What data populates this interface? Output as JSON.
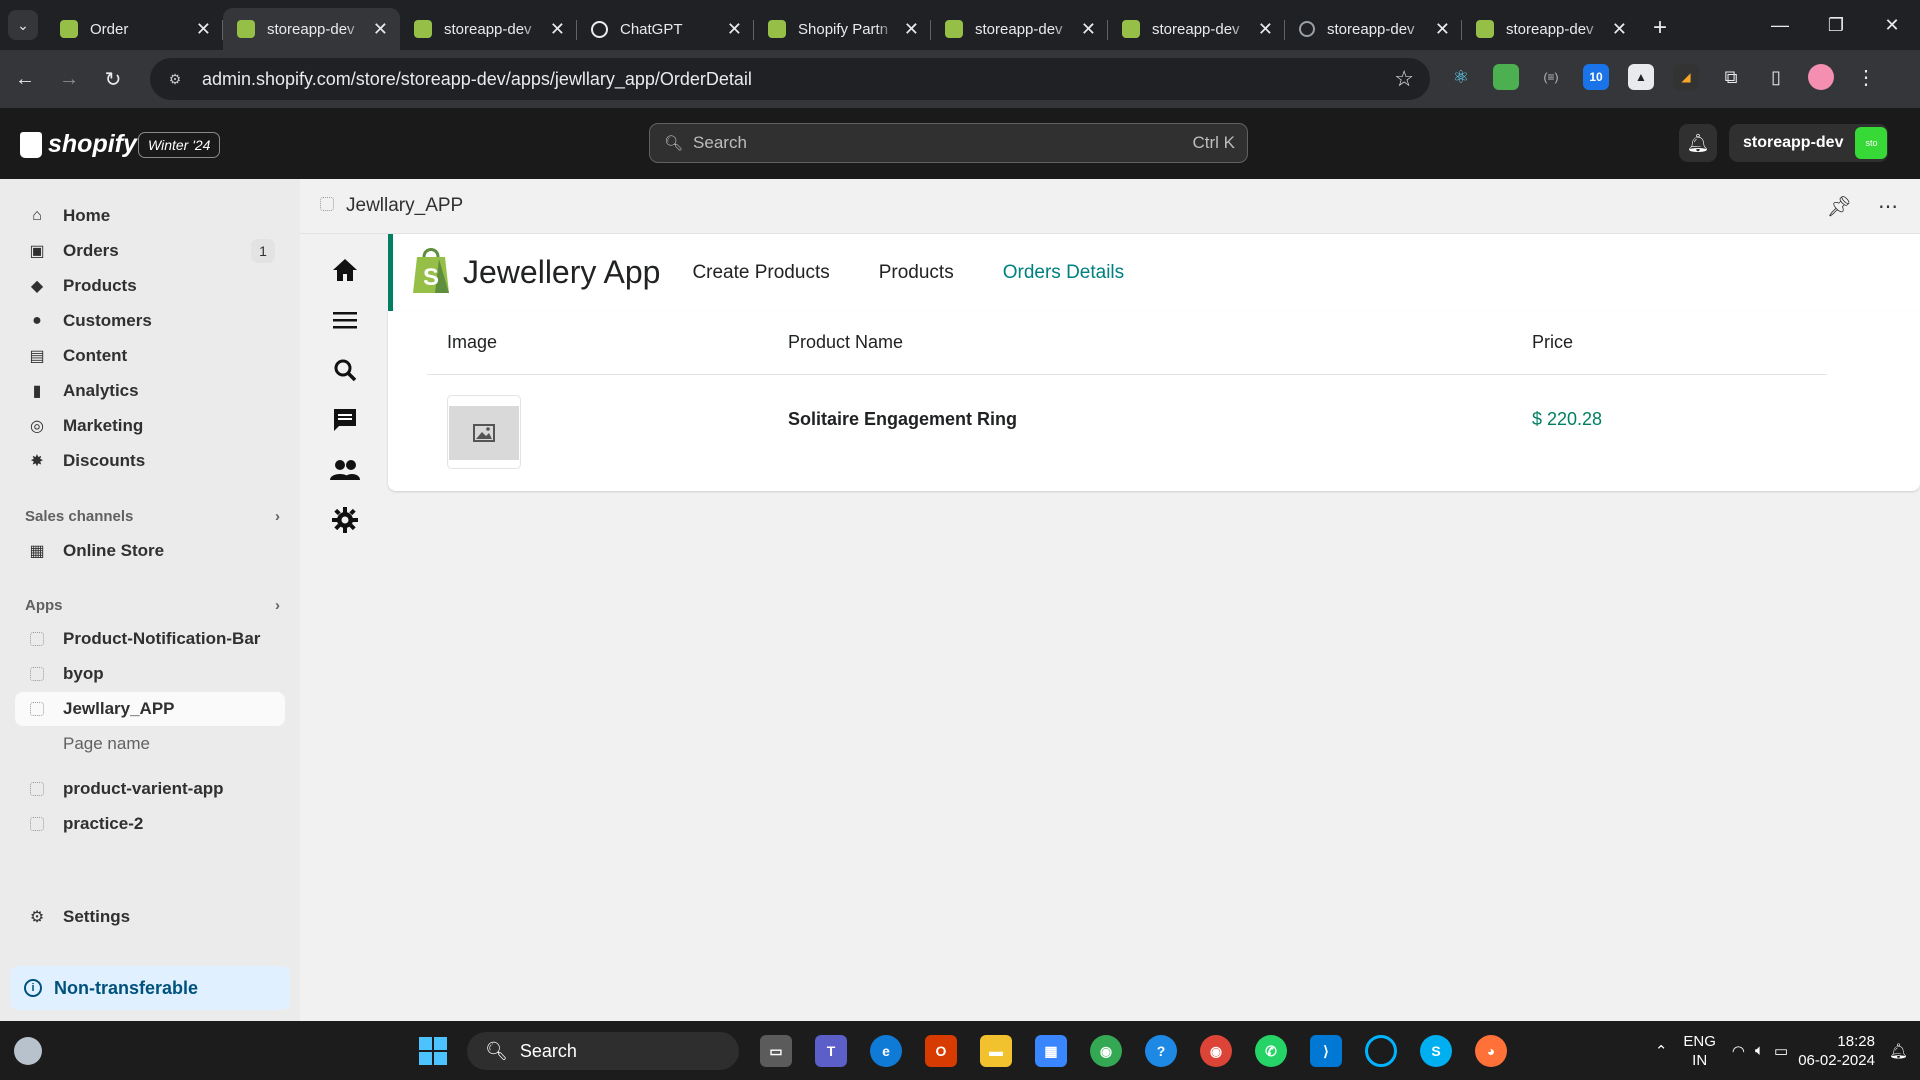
{
  "browser": {
    "tabs": [
      {
        "title": "Order",
        "icon": "shopify-icon",
        "active": false
      },
      {
        "title": "storeapp-dev",
        "icon": "shopify-icon",
        "active": true
      },
      {
        "title": "storeapp-dev",
        "icon": "shopify-icon",
        "active": false
      },
      {
        "title": "ChatGPT",
        "icon": "chatgpt-icon",
        "active": false
      },
      {
        "title": "Shopify Partn",
        "icon": "shopify-icon",
        "active": false
      },
      {
        "title": "storeapp-dev",
        "icon": "shopify-icon",
        "active": false
      },
      {
        "title": "storeapp-dev",
        "icon": "shopify-icon",
        "active": false
      },
      {
        "title": "storeapp-dev",
        "icon": "globe-icon",
        "active": false
      },
      {
        "title": "storeapp-dev",
        "icon": "shopify-icon",
        "active": false
      }
    ],
    "url": "admin.shopify.com/store/storeapp-dev/apps/jewllary_app/OrderDetail"
  },
  "shopify": {
    "brand": "shopify",
    "edition": "Winter '24",
    "search_placeholder": "Search",
    "search_shortcut": "Ctrl K",
    "store_name": "storeapp-dev",
    "store_avatar": "sto",
    "accent_color": "#36d936"
  },
  "sidebar": {
    "items": [
      {
        "label": "Home",
        "icon": "home-icon"
      },
      {
        "label": "Orders",
        "icon": "orders-icon",
        "count": "1"
      },
      {
        "label": "Products",
        "icon": "tag-icon"
      },
      {
        "label": "Customers",
        "icon": "person-icon"
      },
      {
        "label": "Content",
        "icon": "content-icon"
      },
      {
        "label": "Analytics",
        "icon": "bar-chart-icon"
      },
      {
        "label": "Marketing",
        "icon": "target-icon"
      },
      {
        "label": "Discounts",
        "icon": "discount-icon"
      }
    ],
    "sales_channels_label": "Sales channels",
    "online_store": "Online Store",
    "apps_label": "Apps",
    "apps": [
      {
        "label": "Product-Notification-Bar"
      },
      {
        "label": "byop"
      },
      {
        "label": "Jewllary_APP"
      },
      {
        "label": "Page name"
      },
      {
        "label": "product-varient-app"
      },
      {
        "label": "practice-2"
      }
    ],
    "settings": "Settings",
    "non_transferable": "Non-transferable"
  },
  "app_header": {
    "title": "Jewllary_APP"
  },
  "app": {
    "title": "Jewellery App",
    "nav": [
      "Create Products",
      "Products",
      "Orders Details"
    ],
    "active_nav": "Orders Details",
    "link_active_color": "#008080"
  },
  "table": {
    "headers": [
      "Image",
      "Product Name",
      "Price"
    ],
    "rows": [
      {
        "product_name": "Solitaire Engagement Ring",
        "price": "$ 220.28"
      }
    ]
  },
  "taskbar": {
    "search": "Search",
    "lang_line1": "ENG",
    "lang_line2": "IN",
    "time": "18:28",
    "date": "06-02-2024"
  }
}
